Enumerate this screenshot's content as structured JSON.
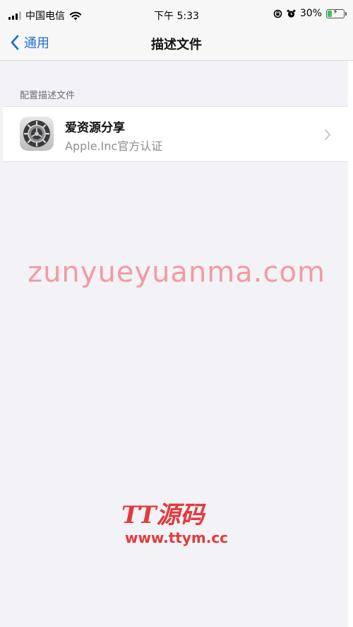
{
  "status_bar": {
    "carrier": "中国电信",
    "time": "下午 5:33",
    "battery_percent": "30%",
    "battery_level": 0.3,
    "icons": [
      "signal-icon",
      "wifi-icon",
      "rotation-lock-icon",
      "alarm-icon",
      "battery-charging-icon"
    ]
  },
  "nav": {
    "back_label": "通用",
    "title": "描述文件"
  },
  "section": {
    "header": "配置描述文件",
    "items": [
      {
        "icon": "settings-gear-icon",
        "name": "爱资源分享",
        "subtitle": "Apple.Inc官方认证"
      }
    ]
  },
  "watermarks": {
    "domain": "zunyueyuanma.com",
    "logo_text": "TT源码",
    "url": "www.ttym.cc"
  },
  "colors": {
    "accent": "#1f6fcf",
    "background": "#f2f2f7",
    "watermark_pink": "#f29aa4",
    "watermark_red": "#e23b3b"
  }
}
